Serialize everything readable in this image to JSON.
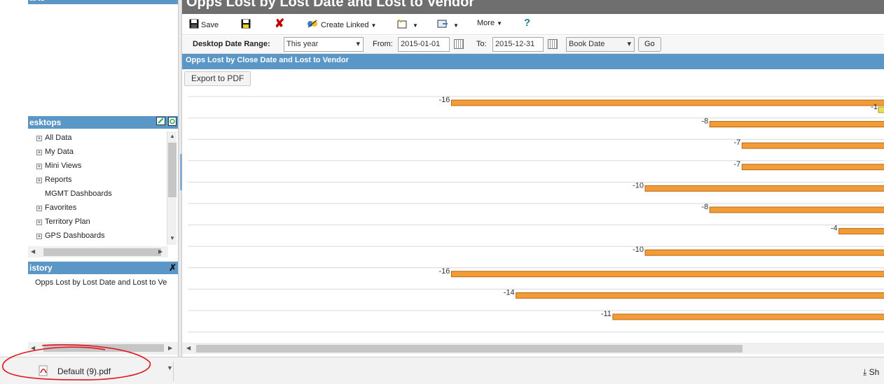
{
  "left_panel": {
    "top_panel_title": "arts",
    "desktops_title": "esktops",
    "desktop_items": [
      {
        "label": "All Data",
        "expandable": true
      },
      {
        "label": "My Data",
        "expandable": true
      },
      {
        "label": "Mini Views",
        "expandable": true
      },
      {
        "label": "Reports",
        "expandable": true
      },
      {
        "label": "MGMT Dashboards",
        "expandable": false
      },
      {
        "label": "Favorites",
        "expandable": true
      },
      {
        "label": "Territory Plan",
        "expandable": true
      },
      {
        "label": "GPS Dashboards",
        "expandable": true
      }
    ],
    "history_title": "istory",
    "history_item": "Opps Lost by Lost Date and Lost to Ve"
  },
  "page_title": "Opps Lost by Lost Date and Lost to Vendor",
  "toolbar": {
    "save_label": "Save",
    "create_linked_label": "Create Linked",
    "more_label": "More",
    "help_label": "?"
  },
  "filters": {
    "date_range_label": "Desktop Date Range:",
    "date_range_value": "This year",
    "from_label": "From:",
    "from_value": "2015-01-01",
    "to_label": "To:",
    "to_value": "2015-12-31",
    "date_field_value": "Book Date",
    "go_label": "Go"
  },
  "report": {
    "section_title": "Opps Lost by Close Date and Lost to Vendor",
    "export_label": "Export to PDF"
  },
  "chart_data": {
    "type": "bar",
    "orientation": "horizontal",
    "categories": [],
    "series": [
      {
        "values": [
          -16,
          -8,
          -7,
          -7,
          -10,
          -8,
          -4,
          -10,
          -16,
          -14,
          -11
        ]
      },
      {
        "values": [
          -1
        ]
      }
    ],
    "data_labels": [
      "-16",
      "-1",
      "-8",
      "-7",
      "-7",
      "-10",
      "-8",
      "-4",
      "-10",
      "-16",
      "-14",
      "-11"
    ],
    "grid": true,
    "colors": {
      "bar": "#f39b35",
      "bar_outline": "#b56a1a",
      "secondary_bar": "#e8e05a"
    }
  },
  "download_bar": {
    "file_name": "Default (9).pdf",
    "show_all_label": "Sh"
  },
  "colors": {
    "header_blue": "#5a96c6",
    "title_gray": "#6f6f6f",
    "annotation_red": "#e0141e"
  }
}
